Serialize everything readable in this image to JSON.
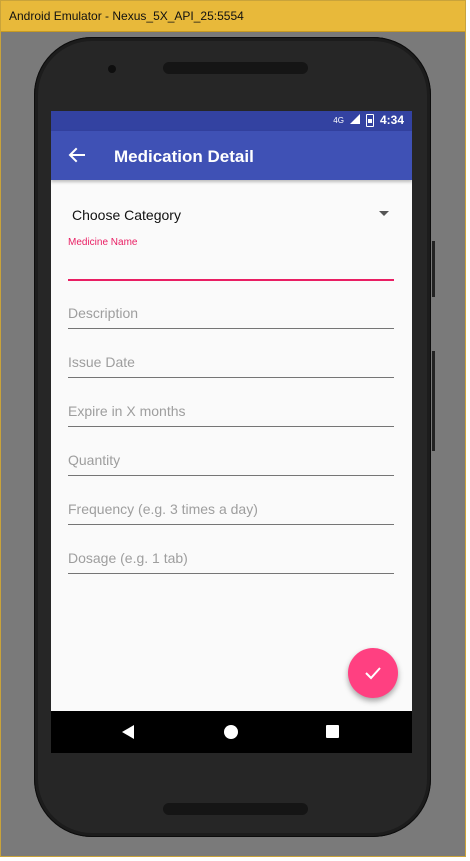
{
  "window": {
    "title": "Android Emulator - Nexus_5X_API_25:5554"
  },
  "statusbar": {
    "network": "4G",
    "time": "4:34"
  },
  "appbar": {
    "title": "Medication Detail",
    "back_icon": "arrow-back-icon"
  },
  "form": {
    "category": {
      "selected": "Choose Category"
    },
    "medicine_name": {
      "label": "Medicine Name",
      "value": ""
    },
    "description": {
      "placeholder": "Description"
    },
    "issue_date": {
      "placeholder": "Issue Date"
    },
    "expire": {
      "placeholder": "Expire in X months"
    },
    "quantity": {
      "placeholder": "Quantity"
    },
    "frequency": {
      "placeholder": "Frequency (e.g. 3 times a day)"
    },
    "dosage": {
      "placeholder": "Dosage (e.g. 1 tab)"
    }
  },
  "fab": {
    "icon": "check-icon"
  },
  "colors": {
    "primary": "#3f51b5",
    "primary_dark": "#3342a1",
    "accent": "#ff4081",
    "field_active": "#e91e63"
  },
  "navbar": {
    "icons": [
      "back-icon",
      "home-icon",
      "recents-icon"
    ]
  }
}
